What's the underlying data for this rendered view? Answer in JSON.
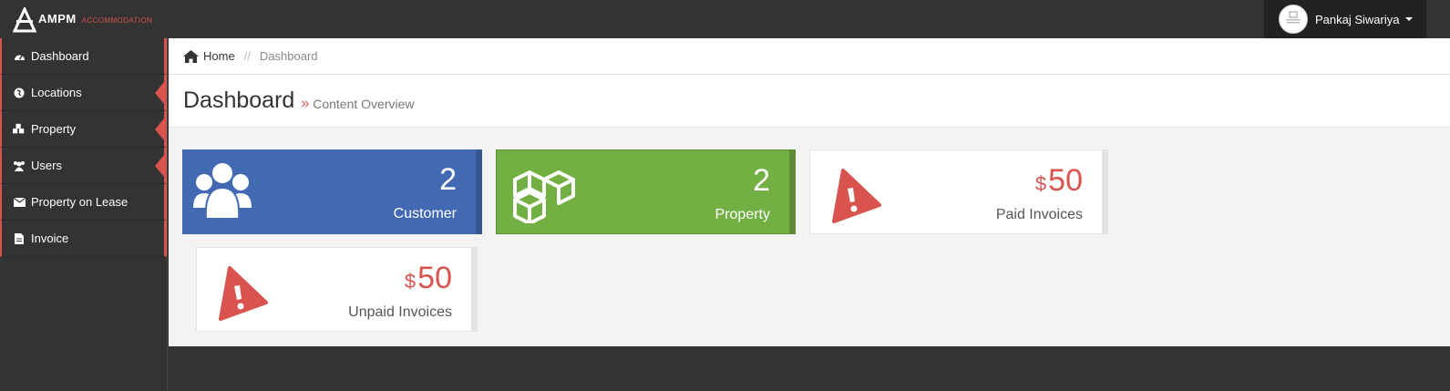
{
  "brand": {
    "name": "AMPM",
    "sub": "ACCOMMODATION"
  },
  "user": {
    "name": "Pankaj Siwariya",
    "avatar_text": "NO IMAGE AVAILABLE"
  },
  "sidebar": {
    "items": [
      {
        "label": "Dashboard",
        "icon": "dashboard-icon"
      },
      {
        "label": "Locations",
        "icon": "globe-icon"
      },
      {
        "label": "Property",
        "icon": "cubes-icon"
      },
      {
        "label": "Users",
        "icon": "users-icon"
      },
      {
        "label": "Property on Lease",
        "icon": "envelope-icon"
      },
      {
        "label": "Invoice",
        "icon": "file-icon"
      }
    ]
  },
  "breadcrumb": {
    "home": "Home",
    "separator": "//",
    "current": "Dashboard"
  },
  "header": {
    "title": "Dashboard",
    "raquo": "»",
    "subtitle": "Content Overview"
  },
  "tiles": {
    "customer": {
      "value": "2",
      "label": "Customer",
      "color": "#4369b3"
    },
    "property": {
      "value": "2",
      "label": "Property",
      "color": "#72b043"
    },
    "paid": {
      "currency": "$",
      "value": "50",
      "label": "Paid Invoices",
      "color": "#d9534f"
    },
    "unpaid": {
      "currency": "$",
      "value": "50",
      "label": "Unpaid Invoices",
      "color": "#d9534f"
    }
  },
  "colors": {
    "accent": "#d9534f",
    "dark": "#333333"
  }
}
